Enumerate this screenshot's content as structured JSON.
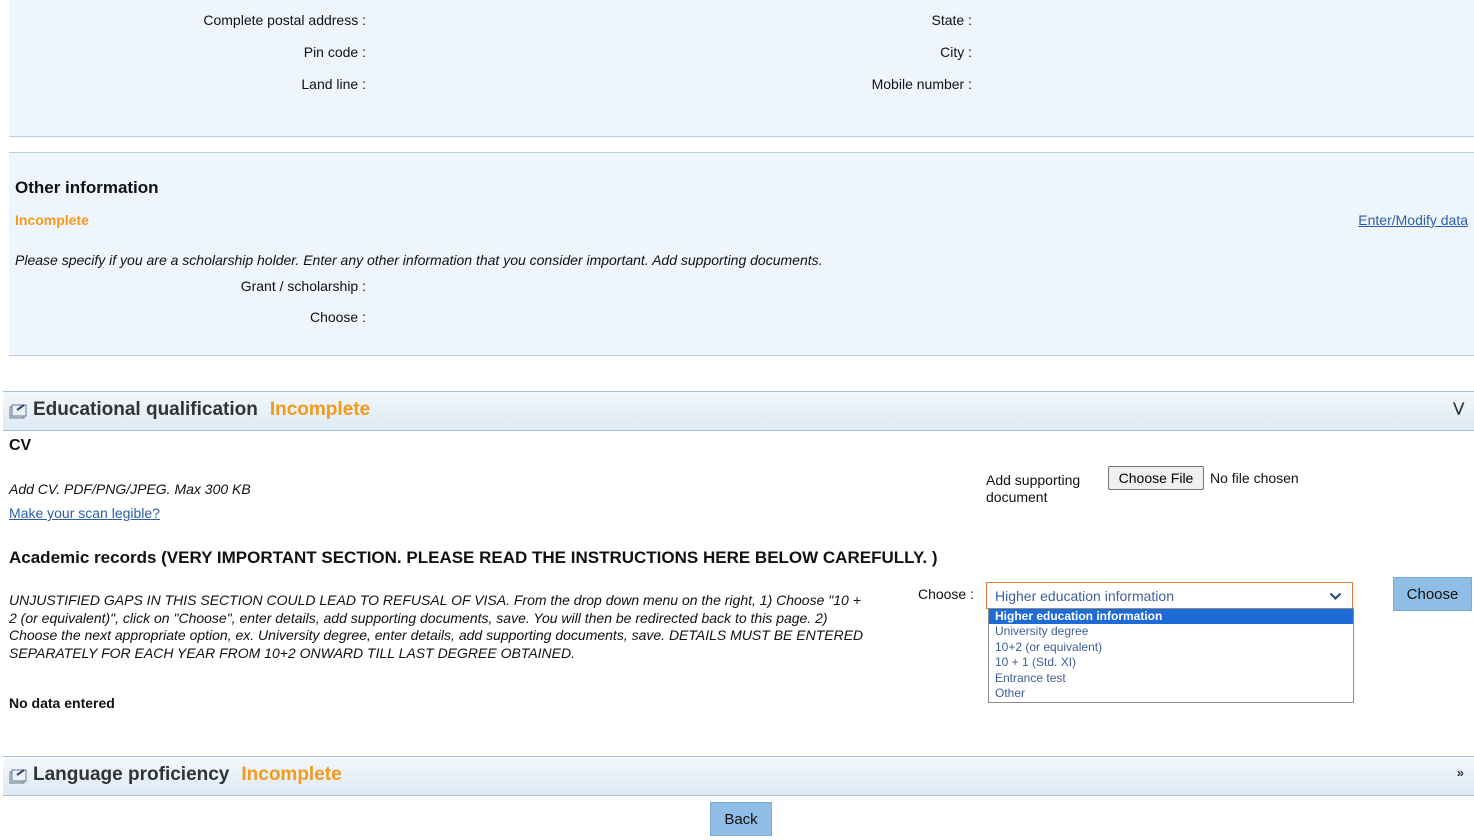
{
  "address": {
    "postal_label": "Complete postal address :",
    "state_label": "State :",
    "pin_label": "Pin code :",
    "city_label": "City :",
    "landline_label": "Land line :",
    "mobile_label": "Mobile number :"
  },
  "other_info": {
    "heading": "Other information",
    "status": "Incomplete",
    "edit_link": "Enter/Modify data",
    "instructions": "Please specify if you are a scholarship holder. Enter any other information that you consider important. Add supporting documents.",
    "grant_label": "Grant / scholarship :",
    "choose_label": "Choose :"
  },
  "education": {
    "title": "Educational qualification",
    "status": "Incomplete",
    "cv_heading": "CV",
    "cv_instructions": "Add CV. PDF/PNG/JPEG. Max 300 KB",
    "scan_link": "Make your scan legible?",
    "supporting_label": "Add supporting document",
    "file_button": "Choose File",
    "file_status": "No file chosen",
    "academic_heading": "Academic records (VERY IMPORTANT SECTION. PLEASE READ THE INSTRUCTIONS HERE BELOW CAREFULLY. )",
    "academic_instructions": "UNJUSTIFIED GAPS IN THIS SECTION COULD LEAD TO REFUSAL OF VISA. From the drop down menu on the right, 1) Choose \"10 + 2 (or equivalent)\", click on \"Choose\", enter details, add supporting documents, save. You will then be redirected back to this page. 2) Choose the next appropriate option, ex. University degree, enter details, add supporting documents, save. DETAILS MUST BE ENTERED SEPARATELY FOR EACH YEAR FROM 10+2 ONWARD TILL LAST DEGREE OBTAINED.",
    "choose_label": "Choose :",
    "select_value": "Higher education information",
    "options": [
      "Higher education information",
      "University degree",
      "10+2 (or equivalent)",
      "10 + 1 (Std. XI)",
      "Entrance test",
      "Other"
    ],
    "choose_button": "Choose",
    "no_data": "No data entered"
  },
  "language": {
    "title": "Language proficiency",
    "status": "Incomplete"
  },
  "footer": {
    "back_button": "Back"
  },
  "colors": {
    "panel_bg": "#eef5fc",
    "status_orange": "#f39a1a",
    "link_blue": "#2c5ea8",
    "button_blue": "#90bde6",
    "selected_option": "#1e6bd6"
  },
  "icons": {
    "section": "section-folder-icon",
    "expand": "double-chevron-icon",
    "select_arrow": "chevron-down-icon"
  }
}
